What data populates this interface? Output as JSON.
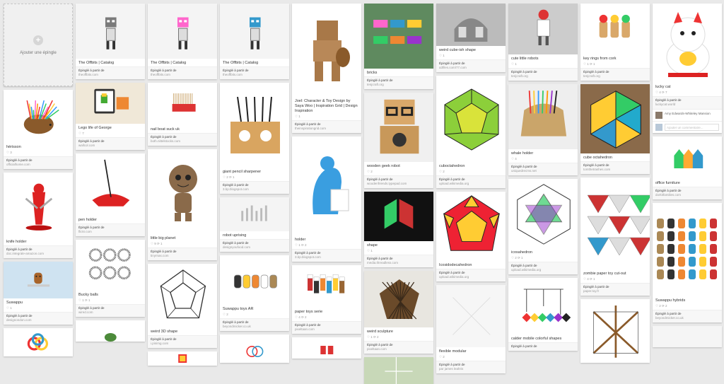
{
  "add_pin": {
    "label": "Ajouter une épingle"
  },
  "repin_label": "Épinglé à partir de",
  "columns": [
    {
      "pins": [
        {
          "add": true
        },
        {
          "title": "hérisson",
          "stats": "♡ 3",
          "source": "officialhome.com",
          "img": "hedgehog"
        },
        {
          "title": "knife holder",
          "stats": "",
          "source": "doc.integrale-amazon.com",
          "img": "knife"
        },
        {
          "title": "Suwappu",
          "stats": "♡ 1",
          "source": "designondon.com",
          "img": "suwappu"
        },
        {
          "title": "",
          "stats": "",
          "source": "",
          "img": "knot"
        }
      ]
    },
    {
      "pins": [
        {
          "title": "The Offbits | Catalog",
          "stats": "",
          "source": "theoffbits.com",
          "img": "robot1"
        },
        {
          "title": "Lego life of George",
          "stats": "♡ 7",
          "source": "wallcol.com",
          "img": "lego"
        },
        {
          "title": "pen holder",
          "stats": "",
          "source": "flickr.com",
          "img": "penholder"
        },
        {
          "title": "Bucky balls",
          "stats": "♡ 1  ⟳ 1",
          "source": "wired.com",
          "img": "bucky"
        },
        {
          "title": "",
          "stats": "",
          "source": "",
          "img": "green"
        }
      ]
    },
    {
      "pins": [
        {
          "title": "The Offbits | Catalog",
          "stats": "",
          "source": "theoffbits.com",
          "img": "robot2"
        },
        {
          "title": "nail boat suck uk",
          "stats": "",
          "source": "both.nittelstocks.com",
          "img": "nailbrush"
        },
        {
          "title": "little big planet",
          "stats": "♡ 9  ⟳ 1",
          "source": "tinyrnas.com",
          "img": "sackboy"
        },
        {
          "title": "weird 3D shape",
          "stats": "",
          "source": "i.pinimg.com",
          "img": "shape3d"
        },
        {
          "title": "",
          "stats": "",
          "source": "",
          "img": "play"
        }
      ]
    },
    {
      "pins": [
        {
          "title": "The Offbits | Catalog",
          "stats": "",
          "source": "theoffbits.com",
          "img": "robot3"
        },
        {
          "title": "giant pencil sharpener",
          "stats": "♡ 2  ⟳ 1",
          "source": "3.bp.blogspot.com",
          "img": "sharpener"
        },
        {
          "title": "robot uprising",
          "stats": "",
          "source": "designyoufood.com",
          "img": "uprising"
        },
        {
          "title": "Suwappu toys AR",
          "stats": "♡ 2",
          "source": "beyondmicker.co.uk",
          "img": "suwappu2"
        },
        {
          "title": "",
          "stats": "",
          "source": "",
          "img": "toyrobot"
        }
      ]
    },
    {
      "pins": [
        {
          "title": "Joel: Character & Toy Design by Saya Woo | Inspiration Grid | Design Inspiration",
          "stats": "♡ 1",
          "source": "theinspirationgrid.com",
          "img": "wooden"
        },
        {
          "title": "holder",
          "stats": "♡ 1  ⟳ 2",
          "source": "3.bp.blogspot.com",
          "img": "holder"
        },
        {
          "title": "paper toys serie",
          "stats": "♡ 4  ⟳ 2",
          "source": "pixeltaan.com",
          "img": "papertoys"
        },
        {
          "title": "",
          "stats": "",
          "source": "",
          "img": "redtoys"
        }
      ]
    },
    {
      "pins": [
        {
          "title": "bricks",
          "stats": "",
          "source": "tenjcraft.org",
          "img": "bricks"
        },
        {
          "title": "wooden geek robot",
          "stats": "♡ 2",
          "source": "woodenfriends.typepad.com",
          "img": "geekrobot"
        },
        {
          "title": "shape",
          "stats": "♡ 1",
          "source": "media.threadless.com",
          "img": "shape"
        },
        {
          "title": "weird sculpture",
          "stats": "♡ 1  ⟳ 2",
          "source": "pixeltaan.com",
          "img": "sculpture"
        },
        {
          "title": "",
          "stats": "",
          "source": "",
          "img": "map"
        }
      ]
    },
    {
      "pins": [
        {
          "title": "weird cube-ish shape",
          "stats": "♡ 1",
          "source": "a3files.com/77.com",
          "img": "cubeish"
        },
        {
          "title": "cuboctahedron",
          "stats": "♡ 2",
          "source": "upload.wikimedia.org",
          "img": "cubocta"
        },
        {
          "title": "Icosidodecahedron",
          "stats": "",
          "source": "upload.wikimedia.org",
          "img": "icosido"
        },
        {
          "title": "flexible modular",
          "stats": "♡ 2",
          "source": "",
          "img": "flexible",
          "via": "par james leahris"
        }
      ]
    },
    {
      "pins": [
        {
          "title": "cute little robots",
          "stats": "♡ 1",
          "source": "tenjcraft.org",
          "img": "cuterobots"
        },
        {
          "title": "whale holder",
          "stats": "♡ 4",
          "source": "uniquedrecms.net",
          "img": "whale"
        },
        {
          "title": "icosahedron",
          "stats": "♡ 2  ⟳ 1",
          "source": "upload.wikimedia.org",
          "img": "icosa"
        },
        {
          "title": "calder mobile colorful shapes",
          "stats": "",
          "source": "",
          "img": "mobile"
        }
      ]
    },
    {
      "pins": [
        {
          "title": "key rings from cork",
          "stats": "♡ 1  ⟳ 1",
          "source": "tenjcraft.org",
          "img": "cork"
        },
        {
          "title": "cube octahedron",
          "stats": "",
          "source": "tomthetrashes.com",
          "img": "cubeocta2"
        },
        {
          "title": "zombie paper toy cut-out",
          "stats": "♡ 4  ⟳ 1",
          "source": "paper.toy.fr",
          "img": "zombie"
        },
        {
          "title": "",
          "stats": "",
          "source": "",
          "img": "tensegrity"
        }
      ]
    },
    {
      "pins": [
        {
          "title": "lucky cat",
          "stats": "♡ 4  ⟳ 7",
          "source": "luckycat.world",
          "img": "luckycat",
          "comment_user": "Amy Edwards-Whiteley Mansion",
          "comment_placeholder": "Ajouter un commentaire..."
        },
        {
          "title": "office furniture",
          "stats": "",
          "source": "dorkitfamilies.com",
          "img": "furniture"
        },
        {
          "title": "Suwappu hybrids",
          "stats": "♡ 2  ⟳ 2",
          "source": "beyondmicker.co.uk",
          "img": "hybrids"
        },
        {
          "title": "",
          "stats": "",
          "source": "",
          "img": "blank"
        }
      ]
    }
  ]
}
